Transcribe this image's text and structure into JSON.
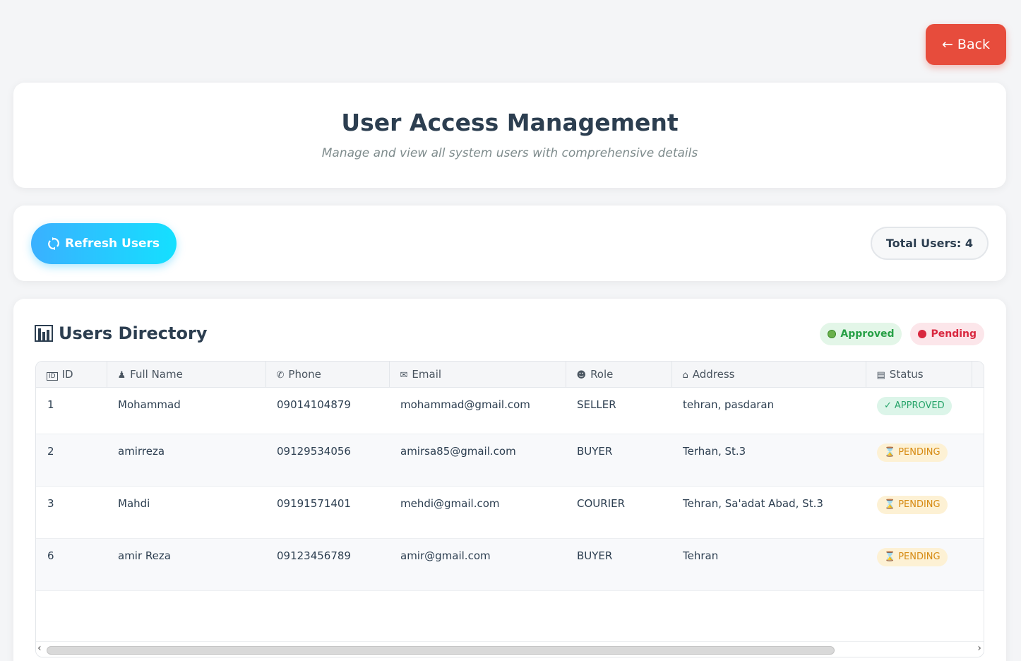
{
  "back_label": "← Back",
  "header": {
    "title": "User Access Management",
    "subtitle": "Manage and view all system users with comprehensive details"
  },
  "toolbar": {
    "refresh_label": "Refresh Users",
    "refresh_icon": "refresh-icon",
    "total_label": "Total Users: 4"
  },
  "directory": {
    "title": "Users Directory",
    "title_icon": "chart-icon",
    "legend": {
      "approved": "Approved",
      "pending": "Pending",
      "approved_color": "#6ab04c",
      "pending_color": "#d9283f"
    },
    "columns": [
      {
        "label": "ID",
        "icon": "id-icon"
      },
      {
        "label": "Full Name",
        "icon": "person-icon"
      },
      {
        "label": "Phone",
        "icon": "phone-icon"
      },
      {
        "label": "Email",
        "icon": "email-icon"
      },
      {
        "label": "Role",
        "icon": "mask-icon"
      },
      {
        "label": "Address",
        "icon": "home-icon"
      },
      {
        "label": "Status",
        "icon": "chart-icon"
      }
    ],
    "rows": [
      {
        "id": "1",
        "name": "Mohammad",
        "phone": "09014104879",
        "email": "mohammad@gmail.com",
        "role": "SELLER",
        "address": "tehran, pasdaran",
        "status": "APPROVED"
      },
      {
        "id": "2",
        "name": "amirreza",
        "phone": "09129534056",
        "email": "amirsa85@gmail.com",
        "role": "BUYER",
        "address": "Terhan, St.3",
        "status": "PENDING"
      },
      {
        "id": "3",
        "name": "Mahdi",
        "phone": "09191571401",
        "email": "mehdi@gmail.com",
        "role": "COURIER",
        "address": "Tehran, Sa'adat Abad, St.3",
        "status": "PENDING"
      },
      {
        "id": "6",
        "name": "amir Reza",
        "phone": "09123456789",
        "email": "amir@gmail.com",
        "role": "BUYER",
        "address": "Tehran",
        "status": "PENDING"
      }
    ]
  }
}
